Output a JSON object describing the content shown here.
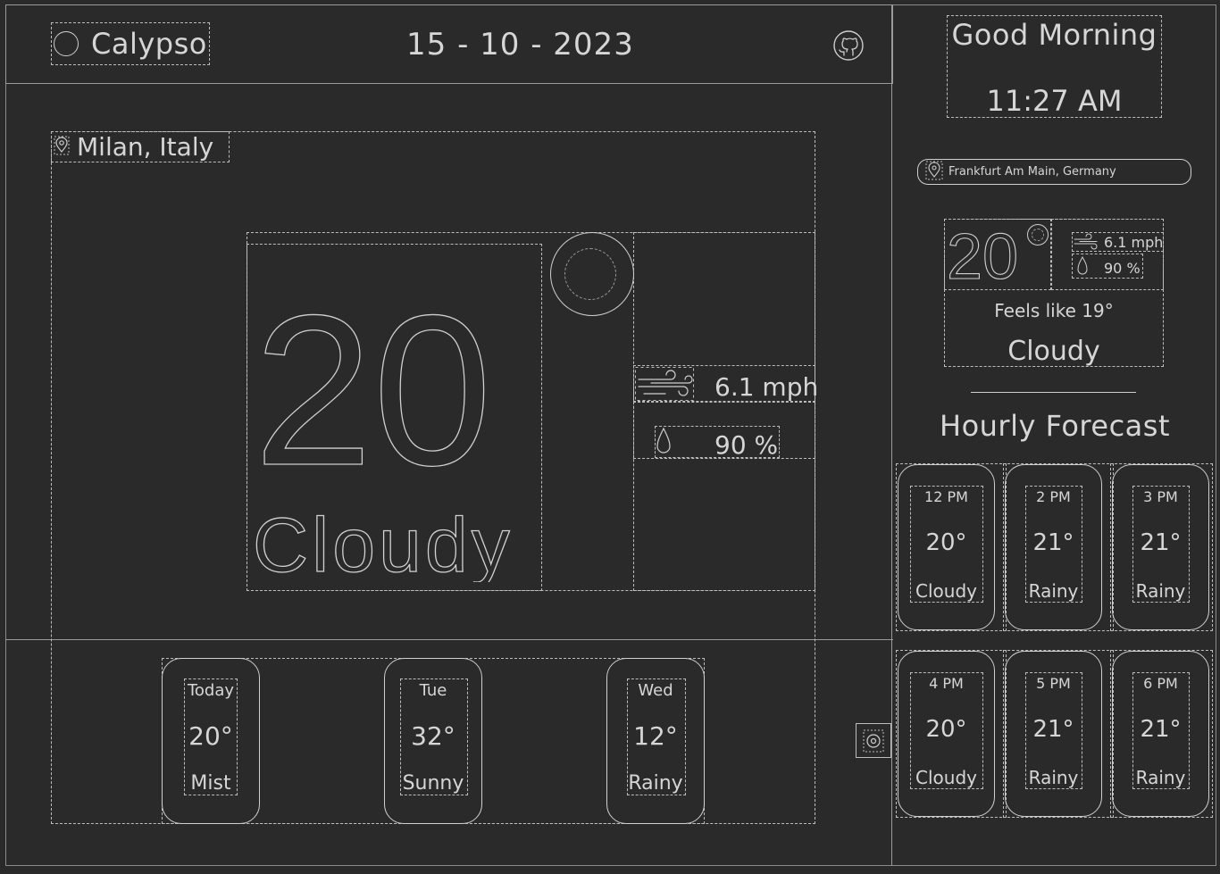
{
  "header": {
    "app_name": "Calypso",
    "date": "15 - 10 - 2023"
  },
  "main": {
    "location": "Milan, Italy",
    "temperature": "20",
    "condition": "Cloudy",
    "wind": "6.1 mph",
    "humidity": "90 %",
    "daily": [
      {
        "day": "Today",
        "temp": "20°",
        "condition": "Mist"
      },
      {
        "day": "Tue",
        "temp": "32°",
        "condition": "Sunny"
      },
      {
        "day": "Wed",
        "temp": "12°",
        "condition": "Rainy"
      }
    ]
  },
  "sidebar": {
    "greeting": "Good Morning",
    "time": "11:27 AM",
    "search_value": "Frankfurt Am Main, Germany",
    "temperature": "20",
    "wind": "6.1 mph",
    "humidity": "90 %",
    "feels_like": "Feels like 19°",
    "condition": "Cloudy",
    "hourly_title": "Hourly Forecast",
    "hourly": [
      {
        "time": "12 PM",
        "temp": "20°",
        "condition": "Cloudy"
      },
      {
        "time": "2 PM",
        "temp": "21°",
        "condition": "Rainy"
      },
      {
        "time": "3 PM",
        "temp": "21°",
        "condition": "Rainy"
      },
      {
        "time": "4 PM",
        "temp": "20°",
        "condition": "Cloudy"
      },
      {
        "time": "5 PM",
        "temp": "21°",
        "condition": "Rainy"
      },
      {
        "time": "6 PM",
        "temp": "21°",
        "condition": "Rainy"
      }
    ]
  },
  "icons": {
    "brand": "circle-logo-icon",
    "github": "github-icon",
    "location": "map-pin-icon",
    "sun": "sun-icon",
    "wind": "wind-icon",
    "humidity": "droplet-icon",
    "side_toggle": "location-toggle-icon"
  },
  "colors": {
    "background": "#2a2a2a",
    "foreground": "#d6d6d6",
    "outline": "#bdbdbd"
  }
}
